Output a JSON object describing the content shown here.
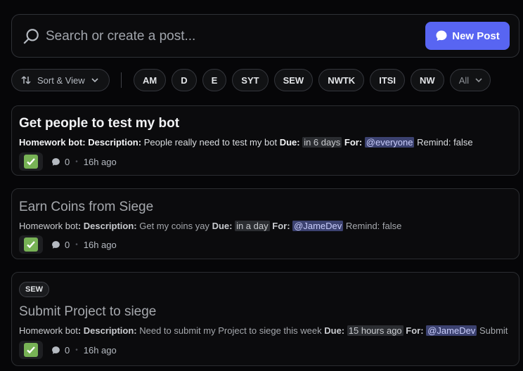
{
  "search": {
    "placeholder": "Search or create a post..."
  },
  "toolbar": {
    "new_post_label": "New Post",
    "sort_label": "Sort & View"
  },
  "tags": [
    "AM",
    "D",
    "E",
    "SYT",
    "SEW",
    "NWTK",
    "ITSI",
    "NW"
  ],
  "tags_all_label": "All",
  "posts": [
    {
      "title": "Get people to test my bot",
      "author": "Homework bot",
      "description_label": ": Description:",
      "description": "People really need to test my bot",
      "due_label": "Due:",
      "due": "in 6 days",
      "for_label": "For:",
      "for": "@everyone",
      "remind": "Remind: false",
      "comments": "0",
      "time": "16h ago"
    },
    {
      "title": "Earn Coins from Siege",
      "author": "Homework bot",
      "description_label": ": Description:",
      "description": "Get my coins yay",
      "due_label": "Due:",
      "due": "in a day",
      "for_label": "For:",
      "for": "@JameDev",
      "remind": "Remind: false",
      "comments": "0",
      "time": "16h ago"
    },
    {
      "tag": "SEW",
      "title": "Submit Project to siege",
      "author": "Homework bot",
      "description_label": ": Description:",
      "description": "Need to submit my Project to siege this week",
      "due_label": "Due:",
      "due": "15 hours ago",
      "for_label": "For:",
      "for": "@JameDev",
      "remind": "Submit",
      "comments": "0",
      "time": "16h ago"
    }
  ],
  "colors": {
    "accent": "#5865f2",
    "check": "#77b255",
    "mention_bg": "#3c4270"
  }
}
